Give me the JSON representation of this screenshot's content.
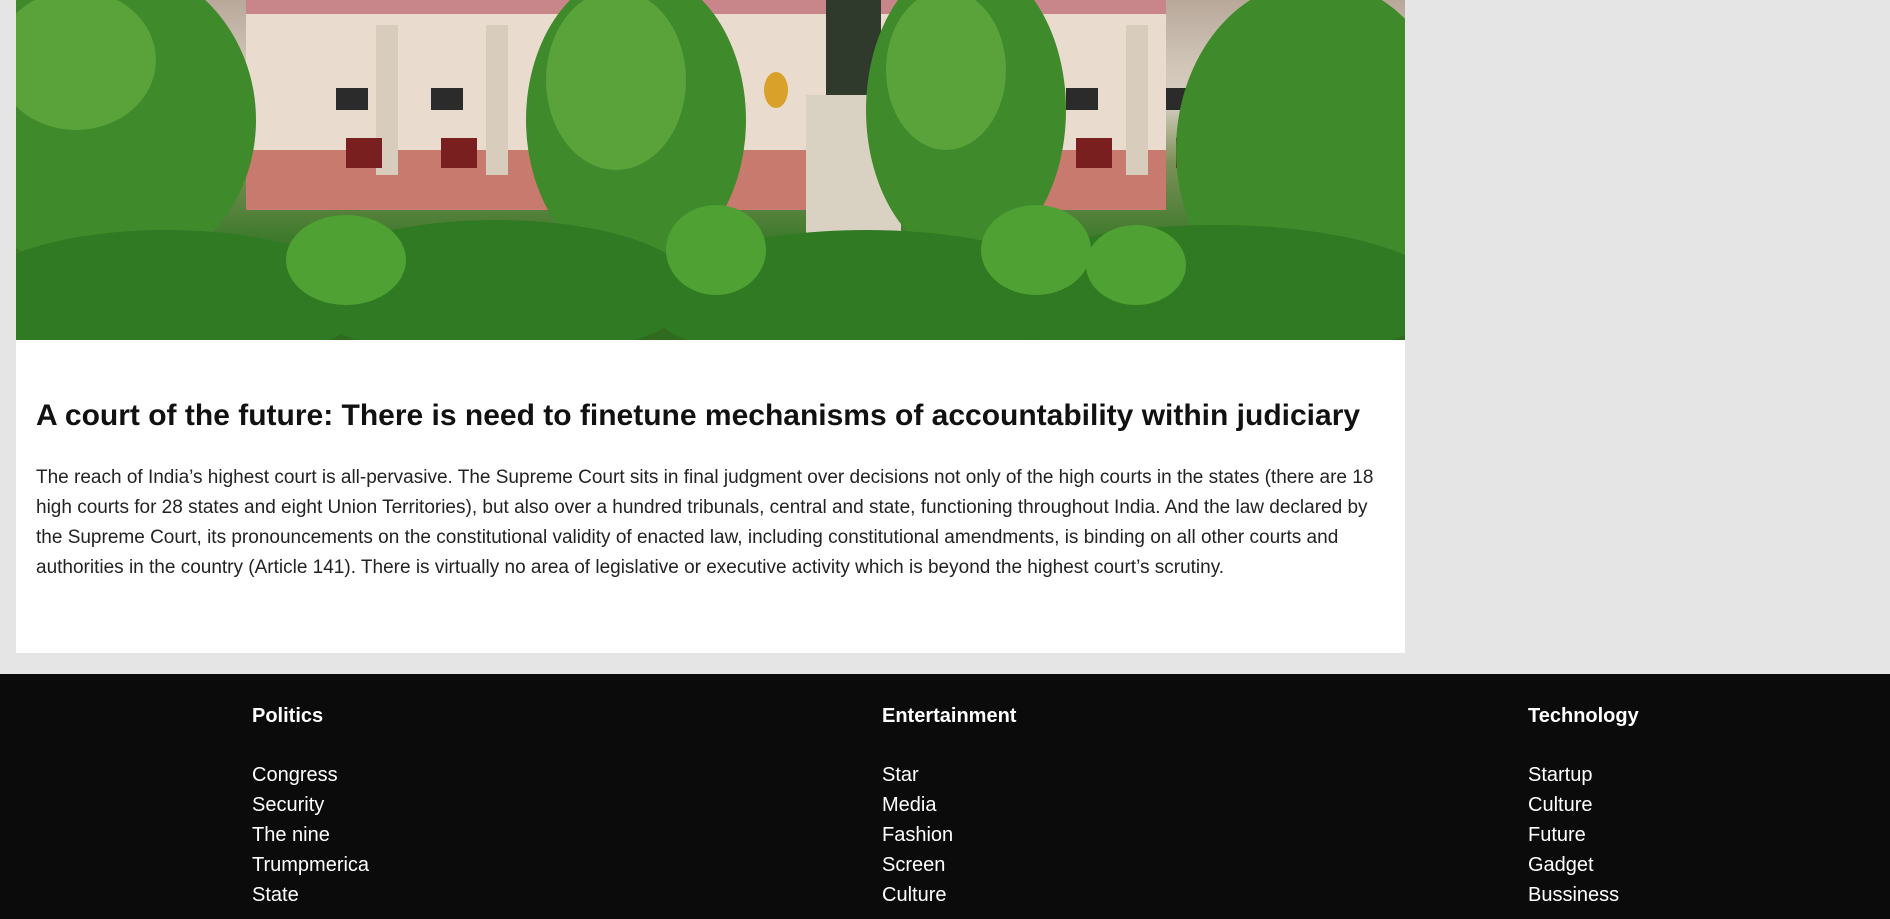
{
  "article": {
    "title": "A court of the future: There is need to finetune mechanisms of accountability within judiciary",
    "body": "The reach of India’s highest court is all-pervasive. The Supreme Court sits in final judgment over decisions not only of the high courts in the states (there are 18 high courts for 28 states and eight Union Territories), but also over a hundred tribunals, central and state, functioning throughout India. And the law declared by the Supreme Court, its pronouncements on the constitutional validity of enacted law, including constitutional amendments, is binding on all other courts and authorities in the country (Article 141). There is virtually no area of legislative or executive activity which is beyond the highest court’s scrutiny.",
    "image": "supreme-court-building-photo"
  },
  "footer": {
    "columns": [
      {
        "heading": "Politics",
        "links": [
          "Congress",
          "Security",
          "The nine",
          "Trumpmerica",
          "State"
        ]
      },
      {
        "heading": "Entertainment",
        "links": [
          "Star",
          "Media",
          "Fashion",
          "Screen",
          "Culture"
        ]
      },
      {
        "heading": "Technology",
        "links": [
          "Startup",
          "Culture",
          "Future",
          "Gadget",
          "Bussiness"
        ]
      }
    ]
  },
  "colors": {
    "page_bg": "#e5e5e5",
    "card_bg": "#ffffff",
    "footer_bg": "#0b0b0b",
    "footer_text": "#ffffff"
  }
}
